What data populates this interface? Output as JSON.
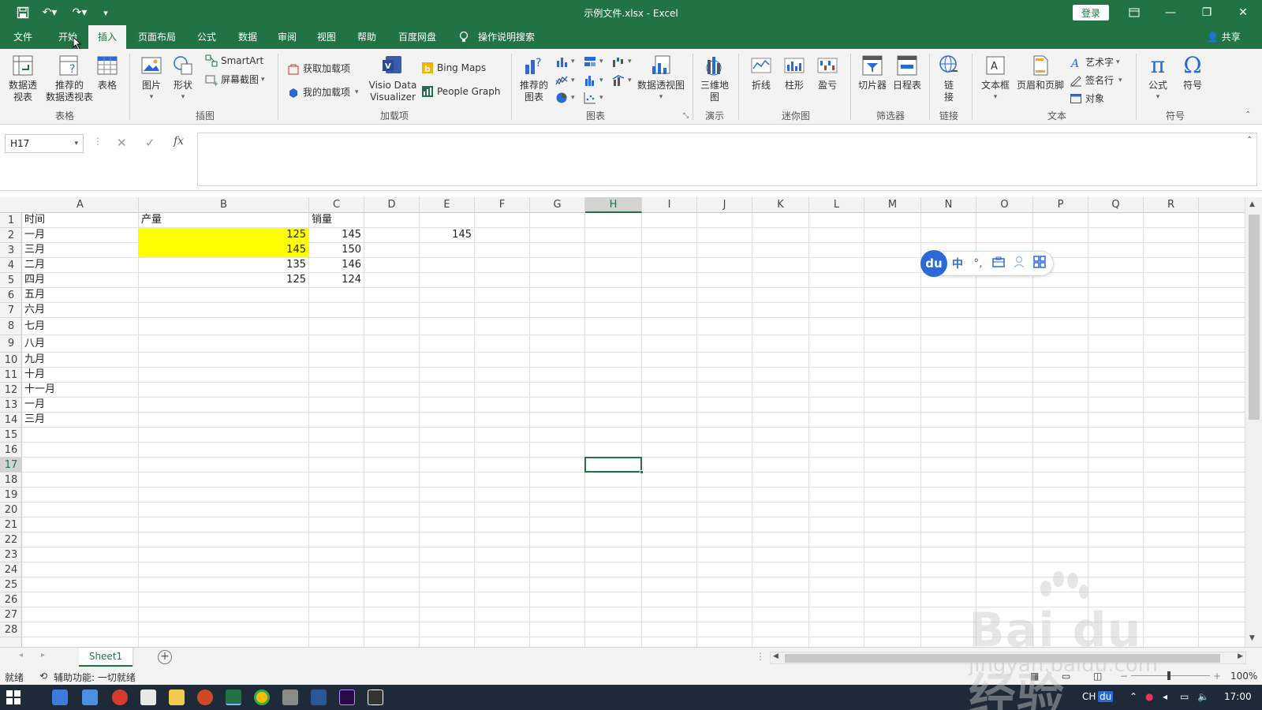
{
  "window": {
    "title": "示例文件.xlsx  -  Excel",
    "login_label": "登录"
  },
  "menu": {
    "tabs": [
      "文件",
      "开始",
      "插入",
      "页面布局",
      "公式",
      "数据",
      "审阅",
      "视图",
      "帮助",
      "百度网盘"
    ],
    "active_tab": "插入",
    "search_label": "操作说明搜索",
    "share_label": "共享"
  },
  "ribbon": {
    "pivot_table": "数据透\n视表",
    "recommended_pivot": "推荐的\n数据透视表",
    "table": "表格",
    "group_tables": "表格",
    "picture": "图片",
    "shapes": "形状",
    "smartart": "SmartArt",
    "screenshot": "屏幕截图",
    "group_illustrations": "插图",
    "get_addins": "获取加载项",
    "my_addins": "我的加载项",
    "visio": "Visio Data\nVisualizer",
    "bing_maps": "Bing Maps",
    "people_graph": "People Graph",
    "group_addins": "加载项",
    "recommended_charts": "推荐的\n图表",
    "pivot_chart": "数据透视图",
    "group_charts": "图表",
    "map3d": "三维地\n图",
    "group_tours": "演示",
    "spark_line": "折线",
    "spark_column": "柱形",
    "spark_winloss": "盈亏",
    "group_sparklines": "迷你图",
    "slicer": "切片器",
    "timeline": "日程表",
    "group_filters": "筛选器",
    "link": "链\n接",
    "group_links": "链接",
    "textbox": "文本框",
    "header_footer": "页眉和页脚",
    "wordart": "艺术字",
    "signature": "签名行",
    "object": "对象",
    "group_text": "文本",
    "equation": "公式",
    "symbol": "符号",
    "group_symbols": "符号"
  },
  "formula_bar": {
    "name_box": "H17",
    "formula": ""
  },
  "grid": {
    "columns": [
      "A",
      "B",
      "C",
      "D",
      "E",
      "F",
      "G",
      "H",
      "I",
      "J",
      "K",
      "L",
      "M",
      "N",
      "O",
      "P",
      "Q",
      "R"
    ],
    "selected_column": "H",
    "rows": [
      "1",
      "2",
      "3",
      "4",
      "5",
      "6",
      "7",
      "8",
      "9",
      "10",
      "11",
      "12",
      "13",
      "14",
      "15",
      "16",
      "17",
      "18",
      "19",
      "20",
      "21",
      "22",
      "23",
      "24",
      "25",
      "26",
      "27",
      "28"
    ],
    "selected_row": "17",
    "cells": {
      "A1": "时间",
      "B1": "产量",
      "C1": "销量",
      "A2": "一月",
      "B2": "125",
      "C2": "145",
      "E2": "145",
      "A3": "三月",
      "B3": "145",
      "C3": "150",
      "A4": "二月",
      "B4": "135",
      "C4": "146",
      "A5": "四月",
      "B5": "125",
      "C5": "124",
      "A6": "五月",
      "A7": "六月",
      "A8": "七月",
      "A9": "八月",
      "A10": "九月",
      "A11": "十月",
      "A12": "十一月",
      "A13": "一月",
      "A14": "三月"
    },
    "highlight_color": "#ffff00"
  },
  "ime": {
    "logo": "du",
    "mode": "中",
    "punct": "°,"
  },
  "sheets": {
    "tabs": [
      "Sheet1"
    ],
    "active": "Sheet1"
  },
  "status": {
    "ready": "就绪",
    "accessibility": "辅助功能: 一切就绪",
    "zoom": "100%"
  },
  "taskbar": {
    "lang": "CH",
    "ime": "du",
    "time": "17:00"
  },
  "watermark": {
    "brand": "Bai du 经验",
    "url": "jingyan.baidu.com"
  },
  "colors": {
    "accent": "#217346"
  }
}
